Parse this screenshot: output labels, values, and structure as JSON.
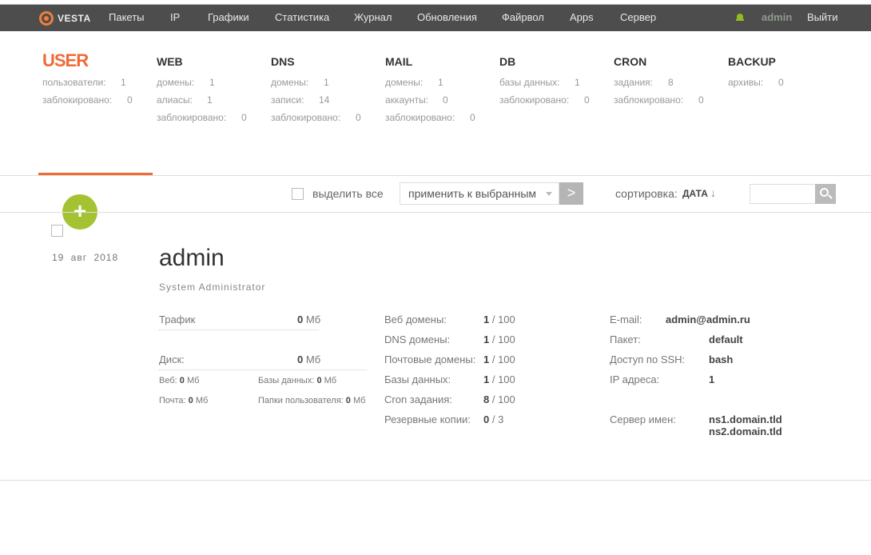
{
  "header": {
    "logo_text": "VESTA",
    "nav": [
      "Пакеты",
      "IP",
      "Графики",
      "Статистика",
      "Журнал",
      "Обновления",
      "Файрвол",
      "Apps",
      "Сервер"
    ],
    "user": "admin",
    "logout": "Выйти"
  },
  "stats": {
    "user": {
      "title": "USER",
      "rows": [
        [
          "пользователи:",
          "1"
        ],
        [
          "заблокировано:",
          "0"
        ]
      ]
    },
    "web": {
      "title": "WEB",
      "rows": [
        [
          "домены:",
          "1"
        ],
        [
          "алиасы:",
          "1"
        ],
        [
          "заблокировано:",
          "0"
        ]
      ]
    },
    "dns": {
      "title": "DNS",
      "rows": [
        [
          "домены:",
          "1"
        ],
        [
          "записи:",
          "14"
        ],
        [
          "заблокировано:",
          "0"
        ]
      ]
    },
    "mail": {
      "title": "MAIL",
      "rows": [
        [
          "домены:",
          "1"
        ],
        [
          "аккаунты:",
          "0"
        ],
        [
          "заблокировано:",
          "0"
        ]
      ]
    },
    "db": {
      "title": "DB",
      "rows": [
        [
          "базы данных:",
          "1"
        ],
        [
          "заблокировано:",
          "0"
        ]
      ]
    },
    "cron": {
      "title": "CRON",
      "rows": [
        [
          "задания:",
          "8"
        ],
        [
          "заблокировано:",
          "0"
        ]
      ]
    },
    "backup": {
      "title": "BACKUP",
      "rows": [
        [
          "архивы:",
          "0"
        ]
      ]
    }
  },
  "toolbar": {
    "add": "+",
    "select_all": "выделить все",
    "apply": "применить к выбранным",
    "go": ">",
    "sort_label": "сортировка:",
    "sort_value": "ДАТА",
    "sort_arrow": "↓",
    "search_placeholder": ""
  },
  "user_row": {
    "date": "19 авг 2018",
    "name": "admin",
    "role": "System Administrator",
    "traffic_label": "Трафик",
    "traffic_value": "0",
    "traffic_unit": "Мб",
    "disk_label": "Диск:",
    "disk_value": "0",
    "disk_unit": "Мб",
    "disk_web_label": "Веб:",
    "disk_web_value": "0",
    "disk_db_label": "Базы данных:",
    "disk_db_value": "0",
    "disk_mail_label": "Почта:",
    "disk_mail_value": "0",
    "disk_dirs_label": "Папки пользователя:",
    "disk_dirs_value": "0",
    "unit": "Мб",
    "limits": [
      {
        "label": "Веб домены:",
        "used": "1",
        "total": "100"
      },
      {
        "label": "DNS домены:",
        "used": "1",
        "total": "100"
      },
      {
        "label": "Почтовые домены:",
        "used": "1",
        "total": "100"
      },
      {
        "label": "Базы данных:",
        "used": "1",
        "total": "100"
      },
      {
        "label": "Cron задания:",
        "used": "8",
        "total": "100"
      },
      {
        "label": "Резервные копии:",
        "used": "0",
        "total": "3"
      }
    ],
    "info": {
      "email_label": "E-mail:",
      "email": "admin@admin.ru",
      "package_label": "Пакет:",
      "package": "default",
      "ssh_label": "Доступ по SSH:",
      "ssh": "bash",
      "ip_label": "IP адреса:",
      "ip": "1",
      "ns_label": "Сервер имен:",
      "ns1": "ns1.domain.tld",
      "ns2": "ns2.domain.tld"
    }
  }
}
